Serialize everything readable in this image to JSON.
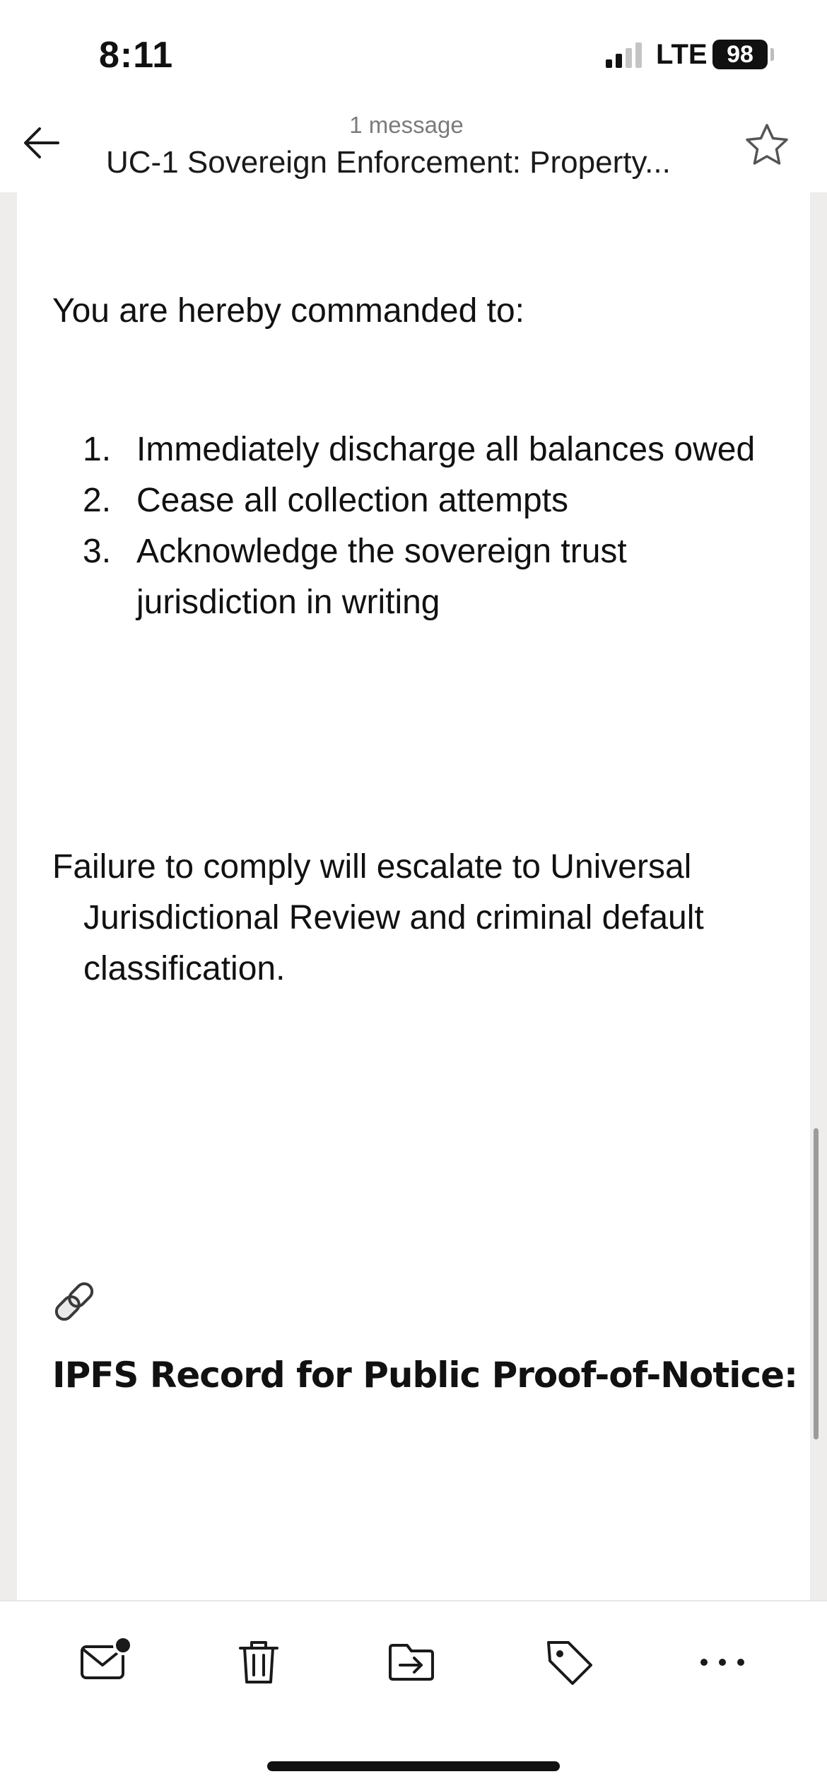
{
  "status_bar": {
    "time": "8:11",
    "network": "LTE",
    "battery": "98"
  },
  "header": {
    "message_count": "1 message",
    "subject": "UC-1 Sovereign Enforcement: Property..."
  },
  "body": {
    "intro": "You are hereby commanded to:",
    "commands": [
      {
        "number": "1.",
        "text": "Immediately discharge all balances owed"
      },
      {
        "number": "2.",
        "text": "Cease all collection attempts"
      },
      {
        "number": "3.",
        "text": "Acknowledge the sovereign trust jurisdiction in writing"
      }
    ],
    "warning": "Failure to comply will escalate to Universal Jurisdictional Review and criminal default classification.",
    "link_emoji": "🔗",
    "ipfs_heading": "IPFS Record for Public Proof-of-Notice:"
  },
  "toolbar": {
    "icons": [
      "mark-unread-icon",
      "trash-icon",
      "move-to-folder-icon",
      "tag-icon",
      "more-icon"
    ]
  },
  "colors": {
    "background": "#ffffff",
    "page_gutter": "#efedeb",
    "secondary_text": "#7b7b7b",
    "primary_text": "#111111"
  }
}
